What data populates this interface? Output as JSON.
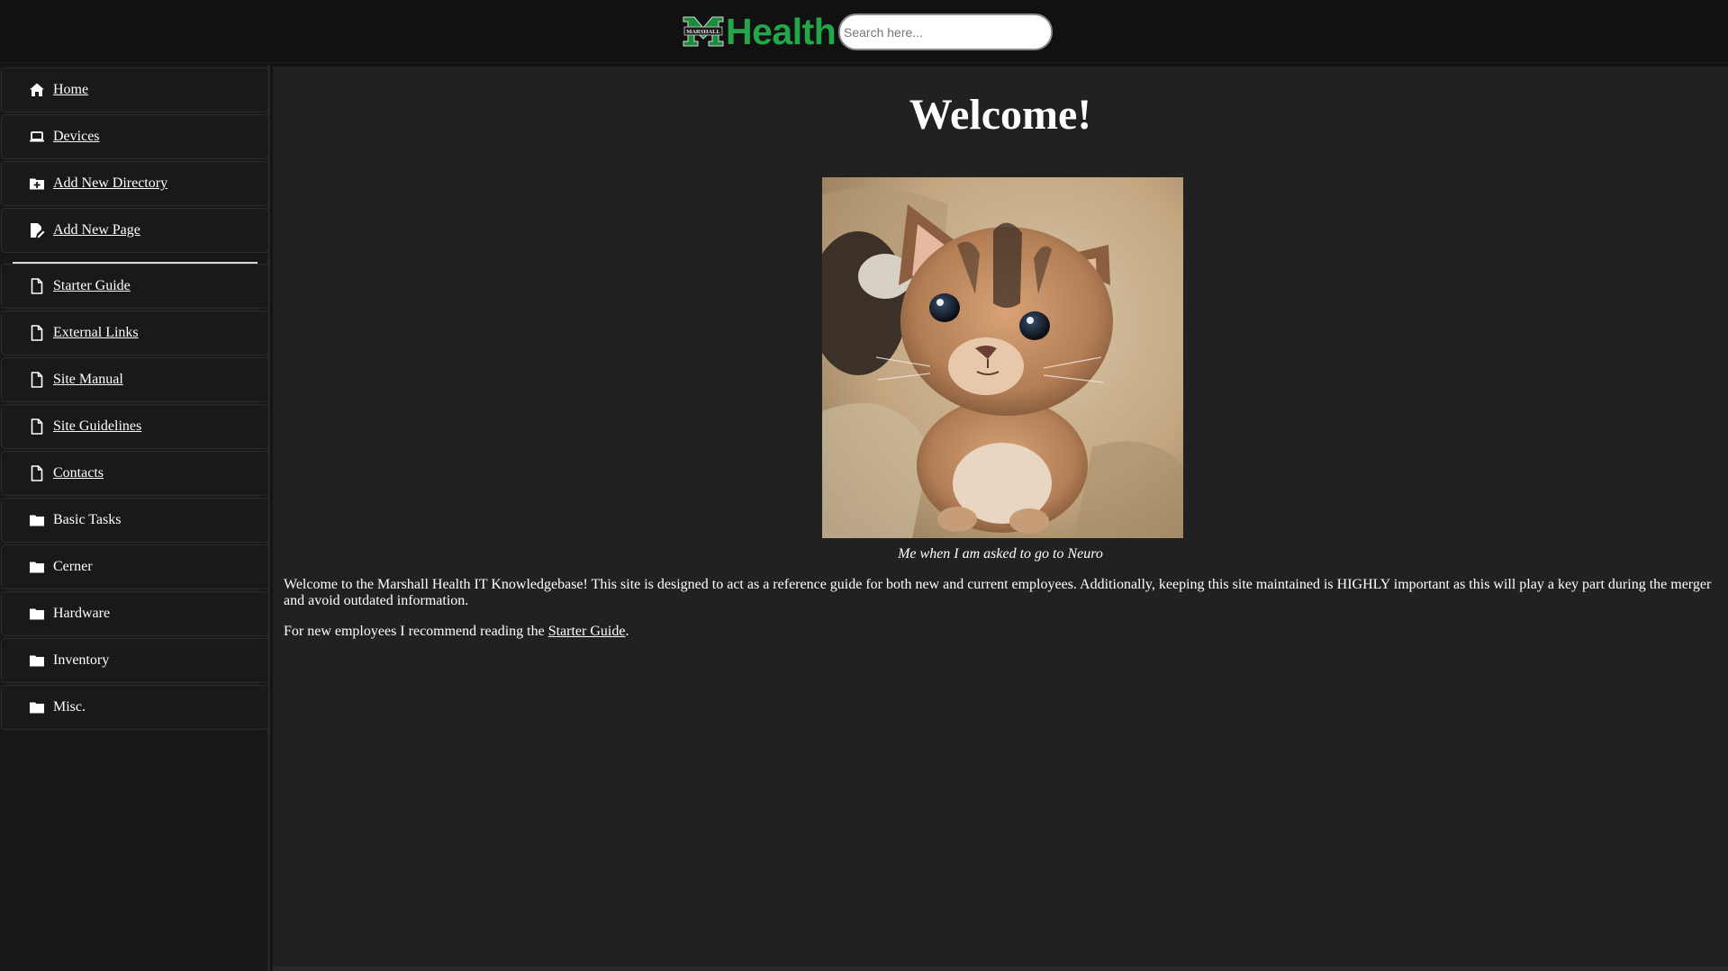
{
  "header": {
    "logo_text": "Health",
    "logo_mark_text": "MARSHALL",
    "brand_color": "#23a74a",
    "search": {
      "placeholder": "Search here...",
      "value": ""
    }
  },
  "sidebar": {
    "items_top": [
      {
        "label": "Home",
        "icon": "home-icon"
      },
      {
        "label": "Devices",
        "icon": "laptop-icon"
      },
      {
        "label": "Add New Directory",
        "icon": "folder-plus-icon"
      },
      {
        "label": "Add New Page",
        "icon": "file-edit-icon"
      }
    ],
    "items_pages": [
      {
        "label": "Starter Guide",
        "icon": "file-icon"
      },
      {
        "label": "External Links",
        "icon": "file-icon"
      },
      {
        "label": "Site Manual",
        "icon": "file-icon"
      },
      {
        "label": "Site Guidelines",
        "icon": "file-icon"
      },
      {
        "label": "Contacts",
        "icon": "file-icon"
      }
    ],
    "items_folders": [
      {
        "label": "Basic Tasks",
        "icon": "folder-icon"
      },
      {
        "label": "Cerner",
        "icon": "folder-icon"
      },
      {
        "label": "Hardware",
        "icon": "folder-icon"
      },
      {
        "label": "Inventory",
        "icon": "folder-icon"
      },
      {
        "label": "Misc.",
        "icon": "folder-icon"
      }
    ]
  },
  "main": {
    "title": "Welcome!",
    "image_caption": "Me when I am asked to go to Neuro",
    "paragraph1": "Welcome to the Marshall Health IT Knowledgebase! This site is designed to act as a reference guide for both new and current employees. Additionally, keeping this site maintained is HIGHLY important as this will play a key part during the merger and avoid outdated information.",
    "paragraph2_prefix": "For new employees I recommend reading the ",
    "paragraph2_link": "Starter Guide",
    "paragraph2_suffix": "."
  }
}
